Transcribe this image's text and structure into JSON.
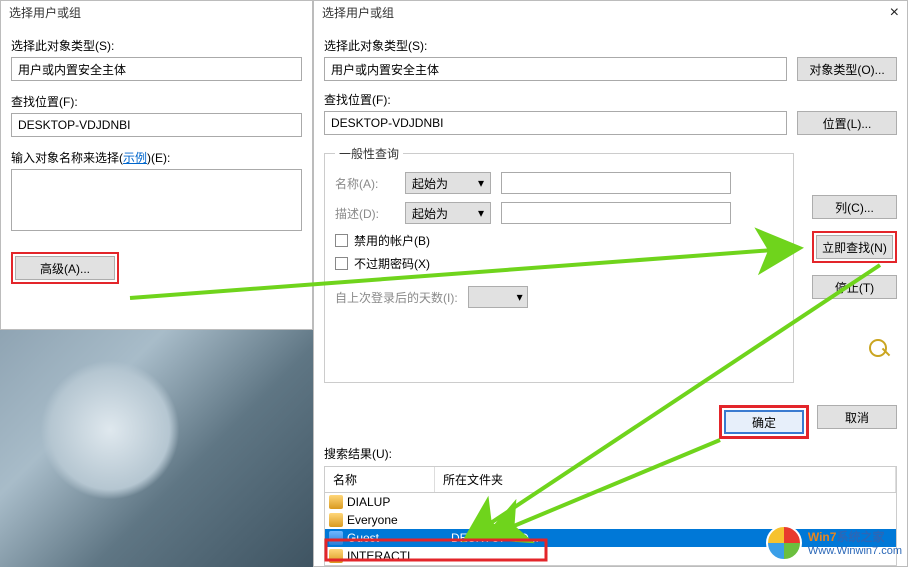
{
  "win1": {
    "title": "选择用户或组",
    "object_type_label": "选择此对象类型(S):",
    "object_type_value": "用户或内置安全主体",
    "location_label": "查找位置(F):",
    "location_value": "DESKTOP-VDJDNBI",
    "enter_names_label_pre": "输入对象名称来选择(",
    "enter_names_link": "示例",
    "enter_names_label_post": ")(E):",
    "advanced_btn": "高级(A)..."
  },
  "win2": {
    "title": "选择用户或组",
    "close": "×",
    "object_type_label": "选择此对象类型(S):",
    "object_type_value": "用户或内置安全主体",
    "object_types_btn": "对象类型(O)...",
    "location_label": "查找位置(F):",
    "location_value": "DESKTOP-VDJDNBI",
    "locations_btn": "位置(L)...",
    "general_query": "一般性查询",
    "name_lbl": "名称(A):",
    "starts_with": "起始为",
    "desc_lbl": "描述(D):",
    "disabled_accounts": "禁用的帐户(B)",
    "no_expire_pwd": "不过期密码(X)",
    "days_since_logon": "自上次登录后的天数(I):",
    "columns_btn": "列(C)...",
    "find_now_btn": "立即查找(N)",
    "stop_btn": "停止(T)",
    "ok_btn": "确定",
    "cancel_btn": "取消",
    "results_lbl": "搜索结果(U):",
    "col_name": "名称",
    "col_folder": "所在文件夹",
    "rows": [
      {
        "icon": "grp",
        "name": "DIALUP",
        "folder": ""
      },
      {
        "icon": "grp",
        "name": "Everyone",
        "folder": ""
      },
      {
        "icon": "usr",
        "name": "Guest",
        "folder": "DESKTOP-VD...",
        "selected": true
      },
      {
        "icon": "grp",
        "name": "INTERACTI",
        "folder": ""
      }
    ]
  },
  "watermark": {
    "line1a": "Win7",
    "line1b": "系统之家",
    "line2": "Www.Winwin7.com"
  }
}
